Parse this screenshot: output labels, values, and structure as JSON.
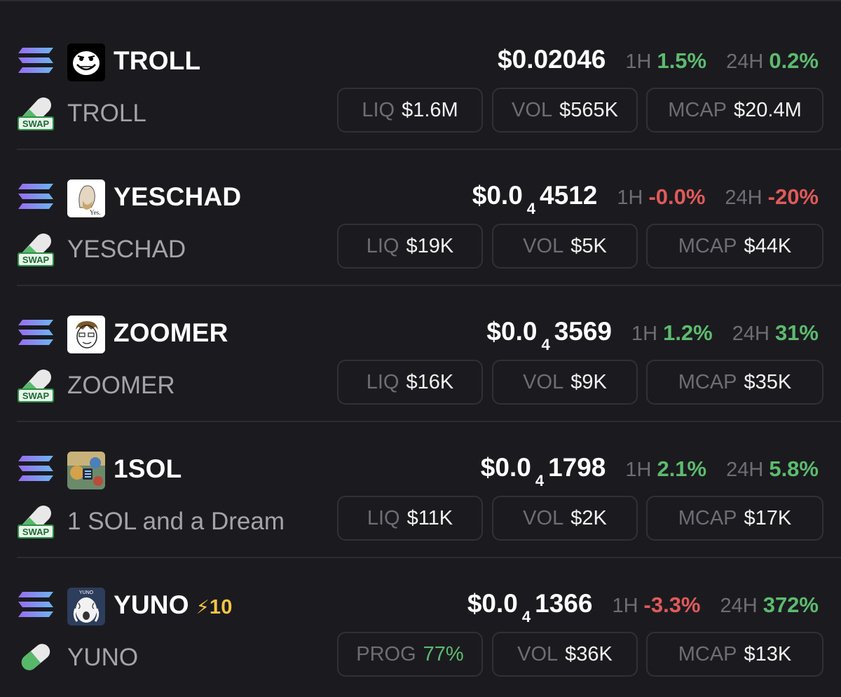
{
  "tokens": [
    {
      "ticker": "TROLL",
      "name": "TROLL",
      "price_main": "$0.02046",
      "price_zeros": "",
      "price_digits": "",
      "h1_label": "1H",
      "h1": "1.5%",
      "h1_dir": "up",
      "h24_label": "24H",
      "h24": "0.2%",
      "h24_dir": "up",
      "stat1_label": "LIQ",
      "stat1": "$1.6M",
      "stat2_label": "VOL",
      "stat2": "$565K",
      "stat3_label": "MCAP",
      "stat3": "$20.4M",
      "avatar_icon": "troll-face-icon",
      "bottom_icon": "swap-icon",
      "boost": ""
    },
    {
      "ticker": "YESCHAD",
      "name": "YESCHAD",
      "price_main": "$0.0",
      "price_zeros": "4",
      "price_digits": "4512",
      "h1_label": "1H",
      "h1": "-0.0%",
      "h1_dir": "down",
      "h24_label": "24H",
      "h24": "-20%",
      "h24_dir": "down",
      "stat1_label": "LIQ",
      "stat1": "$19K",
      "stat2_label": "VOL",
      "stat2": "$5K",
      "stat3_label": "MCAP",
      "stat3": "$44K",
      "avatar_icon": "yes-chad-icon",
      "avatar_text": "Yes.",
      "bottom_icon": "swap-icon",
      "boost": ""
    },
    {
      "ticker": "ZOOMER",
      "name": "ZOOMER",
      "price_main": "$0.0",
      "price_zeros": "4",
      "price_digits": "3569",
      "h1_label": "1H",
      "h1": "1.2%",
      "h1_dir": "up",
      "h24_label": "24H",
      "h24": "31%",
      "h24_dir": "up",
      "stat1_label": "LIQ",
      "stat1": "$16K",
      "stat2_label": "VOL",
      "stat2": "$9K",
      "stat3_label": "MCAP",
      "stat3": "$35K",
      "avatar_icon": "zoomer-face-icon",
      "bottom_icon": "swap-icon",
      "boost": ""
    },
    {
      "ticker": "1SOL",
      "name": "1 SOL and a Dream",
      "price_main": "$0.0",
      "price_zeros": "4",
      "price_digits": "1798",
      "h1_label": "1H",
      "h1": "2.1%",
      "h1_dir": "up",
      "h24_label": "24H",
      "h24": "5.8%",
      "h24_dir": "up",
      "stat1_label": "LIQ",
      "stat1": "$11K",
      "stat2_label": "VOL",
      "stat2": "$2K",
      "stat3_label": "MCAP",
      "stat3": "$17K",
      "avatar_icon": "sol-dream-icon",
      "bottom_icon": "swap-icon",
      "boost": ""
    },
    {
      "ticker": "YUNO",
      "name": "YUNO",
      "price_main": "$0.0",
      "price_zeros": "4",
      "price_digits": "1366",
      "h1_label": "1H",
      "h1": "-3.3%",
      "h1_dir": "down",
      "h24_label": "24H",
      "h24": "372%",
      "h24_dir": "up",
      "stat1_label": "PROG",
      "stat1": "77%",
      "stat2_label": "VOL",
      "stat2": "$36K",
      "stat3_label": "MCAP",
      "stat3": "$13K",
      "avatar_icon": "yuno-face-icon",
      "avatar_text": "YUNO",
      "bottom_icon": "pill-icon",
      "boost": "10",
      "boost_icon": "lightning-icon"
    }
  ],
  "swap_badge": "SWAP",
  "chain_icon": "solana-icon",
  "colors": {
    "up": "#5dbb6f",
    "down": "#e05a5a",
    "boost": "#f5c542",
    "background": "#1b1b1f"
  }
}
